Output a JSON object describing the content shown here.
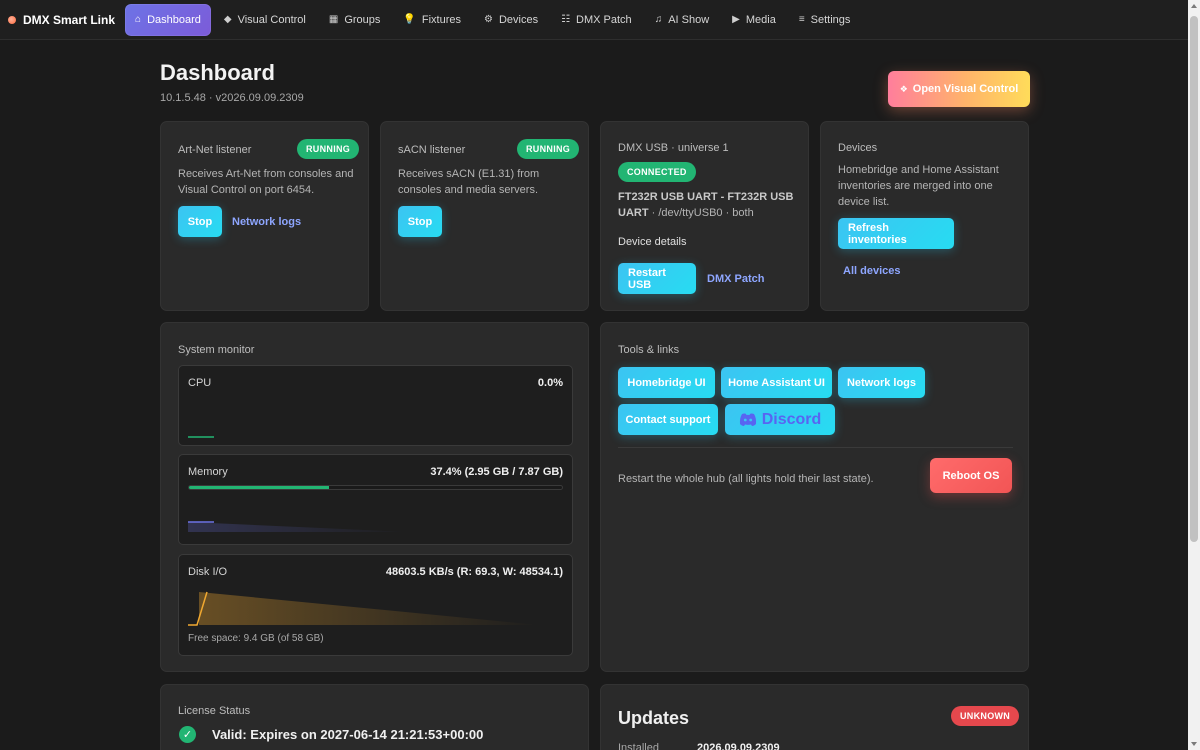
{
  "nav": {
    "brand": "DMX Smart Link",
    "tabs": [
      {
        "icon": "⌂",
        "label": "Dashboard"
      },
      {
        "icon": "◆",
        "label": "Visual Control"
      },
      {
        "icon": "▦",
        "label": "Groups"
      },
      {
        "icon": "💡",
        "label": "Fixtures"
      },
      {
        "icon": "⚙",
        "label": "Devices"
      },
      {
        "icon": "☷",
        "label": "DMX Patch"
      },
      {
        "icon": "♫",
        "label": "AI Show"
      },
      {
        "icon": "▶",
        "label": "Media"
      },
      {
        "icon": "≡",
        "label": "Settings"
      }
    ]
  },
  "header": {
    "title": "Dashboard",
    "subtitle": "10.1.5.48 · v2026.09.09.2309",
    "open_vc_icon": "❖",
    "open_vc_label": "Open Visual Control"
  },
  "artnet": {
    "label": "Art-Net listener",
    "status": "RUNNING",
    "desc": "Receives Art-Net from consoles and Visual Control on port 6454.",
    "stop_label": "Stop",
    "link_label": "Network logs"
  },
  "sacn": {
    "label": "sACN listener",
    "status": "RUNNING",
    "desc": "Receives sACN (E1.31) from consoles and media servers.",
    "stop_label": "Stop"
  },
  "dmxusb": {
    "label": "DMX USB · universe 1",
    "status": "CONNECTED",
    "device_bold": "FT232R USB UART - FT232R USB UART",
    "device_rest": " · /dev/ttyUSB0 · both",
    "details_label": "Device details",
    "restart_label": "Restart USB",
    "link_label": "DMX Patch"
  },
  "devices": {
    "label": "Devices",
    "desc": "Homebridge and Home Assistant inventories are merged into one device list.",
    "refresh_label": "Refresh inventories",
    "link_label": "All devices"
  },
  "monitor": {
    "label": "System monitor",
    "cpu": {
      "title": "CPU",
      "value": "0.0%"
    },
    "memory": {
      "title": "Memory",
      "value": "37.4% (2.95 GB / 7.87 GB)",
      "percent": 37.4
    },
    "disk": {
      "title": "Disk I/O",
      "value": "48603.5 KB/s (R: 69.3, W: 48534.1)",
      "free": "Free space: 9.4 GB (of 58 GB)"
    }
  },
  "tools": {
    "label": "Tools & links",
    "buttons": [
      "Homebridge UI",
      "Home Assistant UI",
      "Network logs",
      "Contact support"
    ],
    "discord_label": "Discord",
    "reboot_text": "Restart the whole hub (all lights hold their last state).",
    "reboot_label": "Reboot OS"
  },
  "license": {
    "label": "License Status",
    "status_text": "Valid: Expires on 2027-06-14 21:21:53+00:00"
  },
  "updates": {
    "title": "Updates",
    "status": "UNKNOWN",
    "installed_key": "Installed",
    "installed_value": "2026.09.09.2309"
  },
  "colors": {
    "accent": "#6d73e6",
    "green": "#22b573",
    "cyan": "#27dcf2",
    "danger": "#e5484d",
    "link": "#8ea6ff"
  }
}
